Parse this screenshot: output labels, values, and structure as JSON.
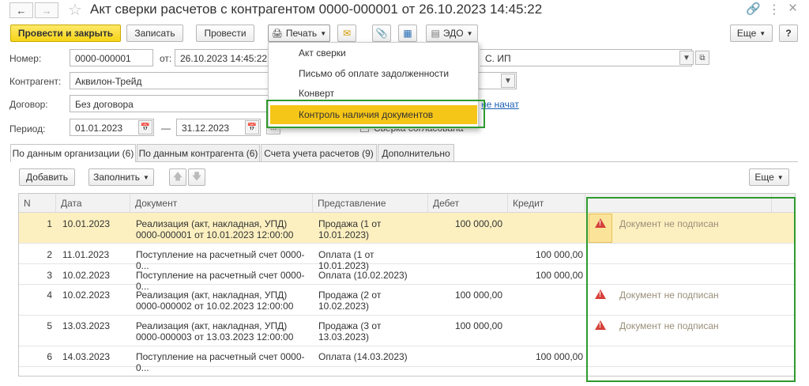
{
  "window": {
    "title": "Акт сверки расчетов с контрагентом 0000-000001 от 26.10.2023 14:45:22",
    "more_label": "⋮",
    "close_label": "×"
  },
  "toolbar": {
    "post_close": "Провести и закрыть",
    "save": "Записать",
    "post": "Провести",
    "print": "Печать",
    "edo": "ЭДО",
    "more": "Еще",
    "help": "?"
  },
  "print_menu": {
    "items": [
      "Акт сверки",
      "Письмо об оплате задолженности",
      "Конверт",
      "Контроль наличия документов"
    ]
  },
  "header": {
    "number_label": "Номер:",
    "number_value": "0000-000001",
    "date_label": "от:",
    "date_value": "26.10.2023 14:45:22",
    "org_value": "С. ИП",
    "counterparty_label": "Контрагент:",
    "counterparty_value": "Аквилон-Трейд",
    "contract_label": "Договор:",
    "contract_value": "Без договора",
    "contract_link": "не начат",
    "period_label": "Период:",
    "period_from": "01.01.2023",
    "period_dash": "—",
    "period_to": "31.12.2023",
    "agreed_label": "Сверка согласована"
  },
  "tabs": [
    "По данным организации (6)",
    "По данным контрагента (6)",
    "Счета учета расчетов (9)",
    "Дополнительно"
  ],
  "table_toolbar": {
    "add": "Добавить",
    "fill": "Заполнить",
    "more": "Еще"
  },
  "table": {
    "columns": [
      "N",
      "Дата",
      "Документ",
      "Представление",
      "Дебет",
      "Кредит",
      ""
    ],
    "rows": [
      {
        "n": "1",
        "date": "10.01.2023",
        "doc": "Реализация (акт, накладная, УПД)\n0000-000001 от 10.01.2023 12:00:00",
        "repr": "Продажа (1 от\n10.01.2023)",
        "debit": "100 000,00",
        "credit": "",
        "status": "Документ не подписан"
      },
      {
        "n": "2",
        "date": "11.01.2023",
        "doc": "Поступление на расчетный счет 0000-0...",
        "repr": "Оплата (1 от 10.01.2023)",
        "debit": "",
        "credit": "100 000,00",
        "status": ""
      },
      {
        "n": "3",
        "date": "10.02.2023",
        "doc": "Поступление на расчетный счет 0000-0...",
        "repr": "Оплата (10.02.2023)",
        "debit": "",
        "credit": "100 000,00",
        "status": ""
      },
      {
        "n": "4",
        "date": "10.02.2023",
        "doc": "Реализация (акт, накладная, УПД)\n0000-000002 от 10.02.2023 12:00:00",
        "repr": "Продажа (2 от\n10.02.2023)",
        "debit": "100 000,00",
        "credit": "",
        "status": "Документ не подписан"
      },
      {
        "n": "5",
        "date": "13.03.2023",
        "doc": "Реализация (акт, накладная, УПД)\n0000-000003 от 13.03.2023 12:00:00",
        "repr": "Продажа (3 от\n13.03.2023)",
        "debit": "100 000,00",
        "credit": "",
        "status": "Документ не подписан"
      },
      {
        "n": "6",
        "date": "14.03.2023",
        "doc": "Поступление на расчетный счет 0000-0...",
        "repr": "Оплата (14.03.2023)",
        "debit": "",
        "credit": "100 000,00",
        "status": ""
      }
    ]
  },
  "colors": {
    "highlight_row": "#fdf0c0",
    "menu_selected": "#f5c518",
    "green_frame": "#2e9a2e",
    "warning": "#d6403a"
  }
}
